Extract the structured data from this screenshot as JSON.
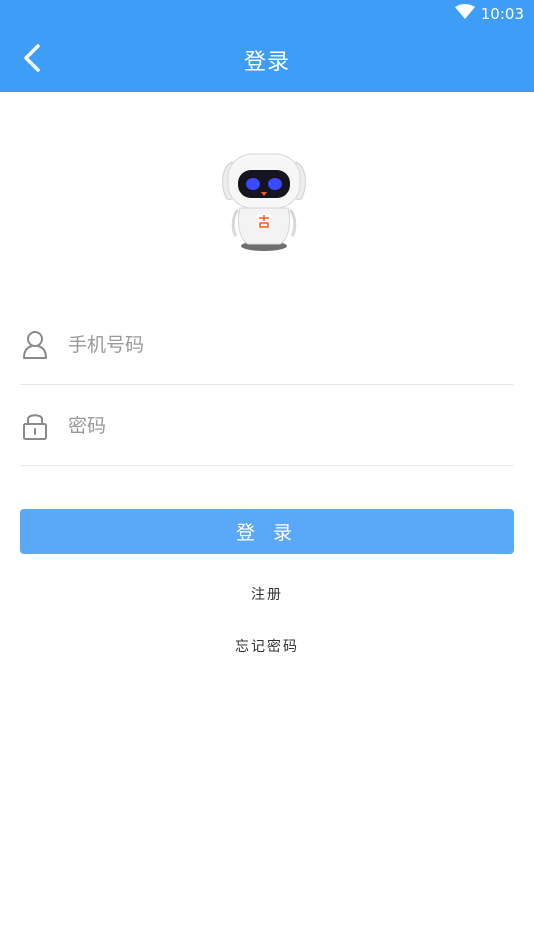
{
  "status_bar": {
    "time": "10:03",
    "icons": [
      "wifi-icon"
    ]
  },
  "header": {
    "title": "登录",
    "back_icon": "chevron-left-icon"
  },
  "form": {
    "phone_placeholder": "手机号码",
    "phone_value": "",
    "password_placeholder": "密码",
    "password_value": "",
    "login_label": "登 录"
  },
  "links": {
    "register": "注册",
    "forgot_password": "忘记密码"
  },
  "colors": {
    "primary": "#3d9df7",
    "button": "#5aa8f8"
  }
}
